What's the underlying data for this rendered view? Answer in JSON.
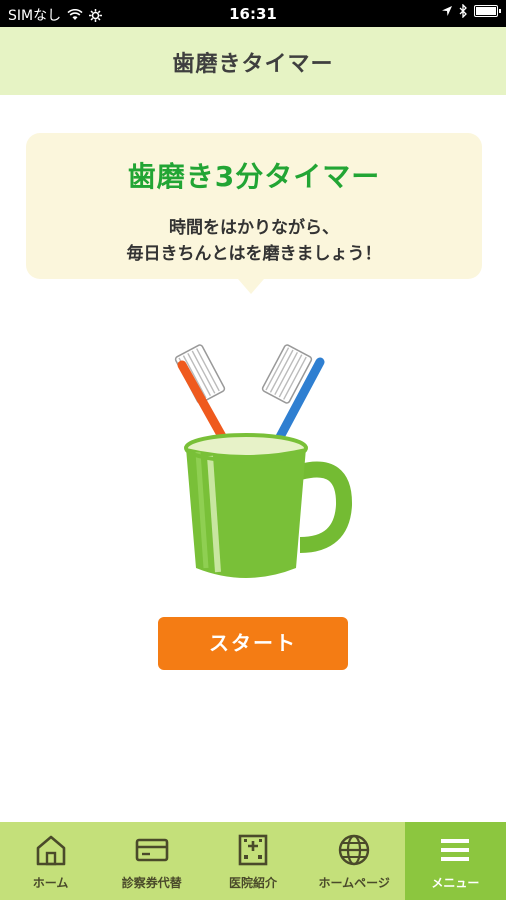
{
  "status_bar": {
    "carrier": "SIMなし",
    "time": "16:31"
  },
  "nav": {
    "title": "歯磨きタイマー"
  },
  "bubble": {
    "title": "歯磨き3分タイマー",
    "line1": "時間をはかりながら、",
    "line2": "毎日きちんとはを磨きましょう！"
  },
  "start_button": {
    "label": "スタート"
  },
  "tabs": [
    {
      "label": "ホーム",
      "icon": "home-icon"
    },
    {
      "label": "診察券代替",
      "icon": "card-icon"
    },
    {
      "label": "医院紹介",
      "icon": "hospital-icon"
    },
    {
      "label": "ホームページ",
      "icon": "globe-icon"
    },
    {
      "label": "メニュー",
      "icon": "menu-icon"
    }
  ],
  "colors": {
    "nav_bg": "#e6f3c4",
    "title_green": "#22a534",
    "button_orange": "#f47c14",
    "tab_bg": "#c4e07a",
    "tab_active": "#8cc63f"
  }
}
